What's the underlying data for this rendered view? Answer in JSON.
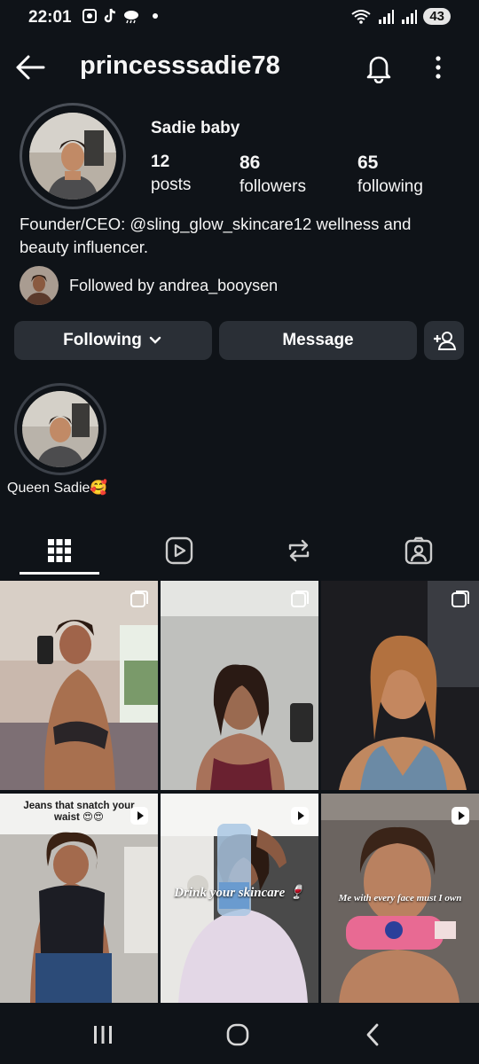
{
  "status_bar": {
    "time": "22:01",
    "battery": "43",
    "left_icons": [
      "screenshot-icon",
      "tiktok-icon",
      "weather-icon"
    ],
    "right_icons": [
      "wifi-icon",
      "signal-icon",
      "signal-icon"
    ]
  },
  "header": {
    "username": "princesssadie78"
  },
  "profile": {
    "display_name": "Sadie baby",
    "posts_count": "12",
    "posts_label": "posts",
    "followers_count": "86",
    "followers_label": "followers",
    "following_count": "65",
    "following_label": "following",
    "bio_line1": "Founder/CEO: @sling_glow_skincare12 wellness and",
    "bio_line2": "beauty influencer.",
    "followed_by": "Followed by andrea_booysen"
  },
  "actions": {
    "following_label": "Following",
    "message_label": "Message"
  },
  "highlights": [
    {
      "label": "Queen Sadie🥰"
    }
  ],
  "tabs": [
    "grid-icon",
    "reels-icon",
    "reposts-icon",
    "tagged-icon"
  ],
  "grid": {
    "cell4_text_line1": "Jeans that snatch your",
    "cell4_text_line2": "waist 😍😍",
    "cell5_text": "Drink your skincare 🍷",
    "cell6_text": "Me with every face must I own"
  },
  "colors": {
    "background": "#0f1318",
    "button": "#2a2f36",
    "text": "#f5f5f5"
  }
}
